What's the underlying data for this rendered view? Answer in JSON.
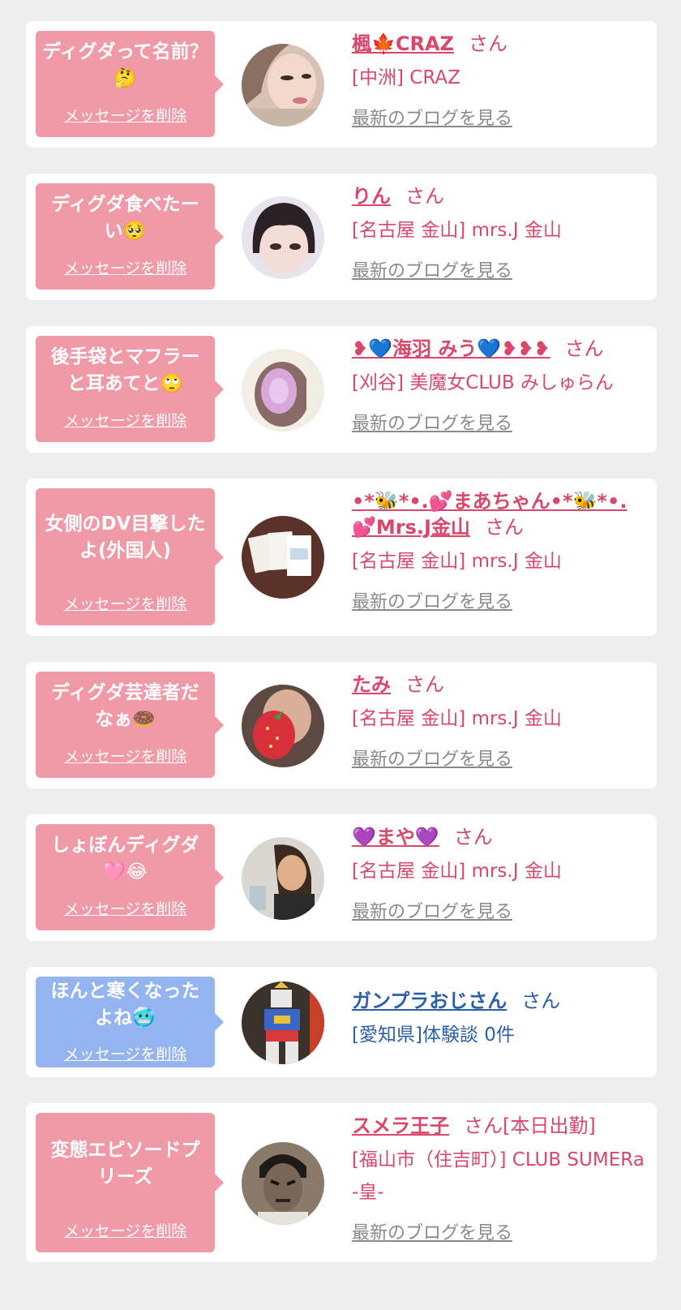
{
  "common": {
    "delete_label": "メッセージを削除",
    "blog_label": "最新のブログを見る",
    "san": "さん"
  },
  "cards": [
    {
      "message": "ディグダって名前？🤔",
      "name": "楓🍁CRAZ",
      "suffix": "",
      "shop": "[中洲] CRAZ"
    },
    {
      "message": "ディグダ食べたーい🥺",
      "name": "りん",
      "suffix": "",
      "shop": "[名古屋 金山] mrs.J 金山"
    },
    {
      "message": "後手袋とマフラーと耳あてと🙄",
      "name": "❥💙海羽 みう💙❥❥❥",
      "suffix": "",
      "shop": "[刈谷] 美魔女CLUB みしゅらん"
    },
    {
      "message": "女側のDV目撃したよ(外国人)",
      "name": "•*🐝*•.💕まあちゃん•*🐝*•.💕Mrs.J金山",
      "suffix": "",
      "shop": "[名古屋 金山] mrs.J 金山"
    },
    {
      "message": "ディグダ芸達者だなぁ🍩",
      "name": "たみ",
      "suffix": "",
      "shop": "[名古屋 金山] mrs.J 金山"
    },
    {
      "message": "しょぼんディグダ🩷😂",
      "name": "💜まや💜",
      "suffix": "",
      "shop": "[名古屋 金山] mrs.J 金山"
    },
    {
      "message": "ほんと寒くなったよね🥶",
      "name": "ガンプラおじさん",
      "suffix": "",
      "shop": "[愛知県]体験談 0件"
    },
    {
      "message": "変態エピソードプリーズ",
      "name": "スメラ王子",
      "suffix": "[本日出勤]",
      "shop": "[福山市（住吉町）] CLUB SUMERa -皇-"
    }
  ],
  "colors": {
    "page_bg": "#eeeeee",
    "bubble_pink": "#ef9aa6",
    "bubble_blue": "#93b4ee",
    "name_pink": "#d9486a",
    "name_blue": "#2b5fa8",
    "blog_gray": "#8a8a8a"
  }
}
